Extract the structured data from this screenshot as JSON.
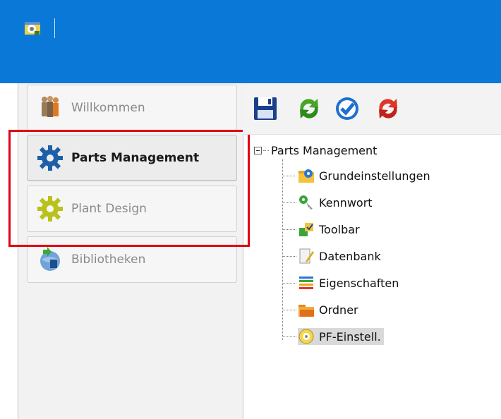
{
  "app": {
    "icon": "app-gear-icon",
    "accent_color": "#0a78d7"
  },
  "nav": {
    "items": [
      {
        "label": "Willkommen",
        "icon": "people-icon",
        "active": false
      },
      {
        "label": "Parts Management",
        "icon": "blue-gear-icon",
        "active": true
      },
      {
        "label": "Plant Design",
        "icon": "yellow-gear-icon",
        "active": false
      },
      {
        "label": "Bibliotheken",
        "icon": "library-globe-icon",
        "active": false
      }
    ],
    "highlight_color": "#e3000f"
  },
  "toolbar": {
    "buttons": [
      {
        "name": "save",
        "icon": "floppy-disk-icon"
      },
      {
        "name": "refresh",
        "icon": "green-refresh-icon"
      },
      {
        "name": "confirm",
        "icon": "blue-check-icon"
      },
      {
        "name": "reset",
        "icon": "red-refresh-icon"
      }
    ]
  },
  "tree": {
    "root": "Parts Management",
    "children": [
      {
        "label": "Grundeinstellungen",
        "icon": "folder-gear-icon"
      },
      {
        "label": "Kennwort",
        "icon": "key-icon"
      },
      {
        "label": "Toolbar",
        "icon": "toolbar-puzzle-icon"
      },
      {
        "label": "Datenbank",
        "icon": "document-pencil-icon"
      },
      {
        "label": "Eigenschaften",
        "icon": "colored-lines-icon"
      },
      {
        "label": "Ordner",
        "icon": "folder-icon"
      },
      {
        "label": "PF-Einstell.",
        "icon": "pf-settings-icon",
        "selected": true
      }
    ]
  }
}
